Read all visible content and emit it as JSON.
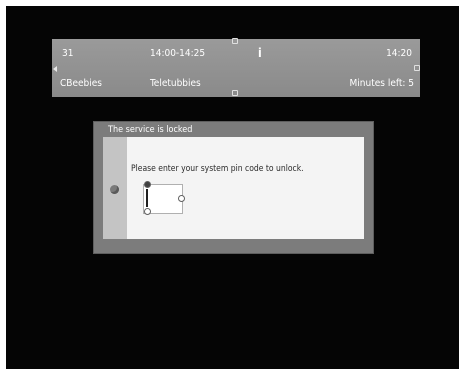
{
  "infobar": {
    "channel_number": "31",
    "time_range": "14:00-14:25",
    "info_label": "i",
    "clock": "14:20",
    "channel_name": "CBeebies",
    "programme": "Teletubbies",
    "minutes_left": "Minutes left: 5"
  },
  "dialog": {
    "title": "The service is locked",
    "message": "Please enter your system pin code to unlock.",
    "pin_value": ""
  },
  "colors": {
    "background": "#050505",
    "infobar": "#929292",
    "dialog_frame": "#7c7c7c",
    "dialog_body": "#f4f4f4"
  },
  "icons": [
    "nav-left-arrow-icon",
    "info-icon",
    "lock-icon",
    "text-cursor-icon"
  ]
}
